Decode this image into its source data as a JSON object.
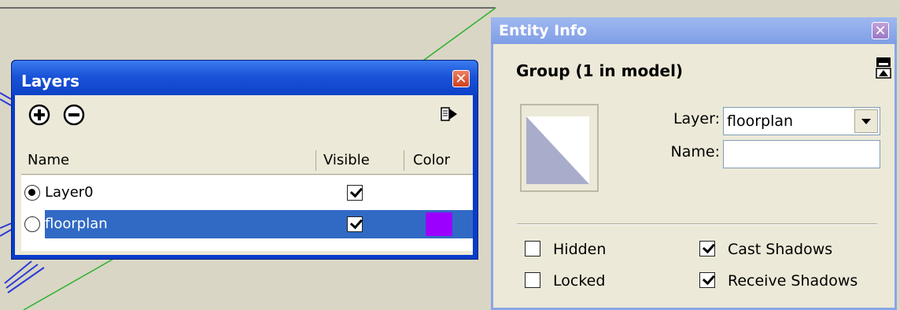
{
  "layers_panel": {
    "title": "Layers",
    "columns": [
      "Name",
      "Visible",
      "Color"
    ],
    "rows": [
      {
        "name": "Layer0",
        "active": true,
        "visible": true,
        "color": "#ffffff"
      },
      {
        "name": "floorplan",
        "active": false,
        "visible": true,
        "selected": true,
        "color": "#9b00ff"
      }
    ],
    "toolbar": {
      "add_icon": "add-layer-icon",
      "remove_icon": "remove-layer-icon",
      "details_icon": "details-arrow-icon"
    }
  },
  "entity_info": {
    "title": "Entity Info",
    "heading": "Group (1 in model)",
    "layer_label": "Layer:",
    "layer_value": "floorplan",
    "name_label": "Name:",
    "name_value": "",
    "options": {
      "hidden": {
        "label": "Hidden",
        "checked": false
      },
      "locked": {
        "label": "Locked",
        "checked": false
      },
      "cast_shadows": {
        "label": "Cast Shadows",
        "checked": true
      },
      "receive_shadows": {
        "label": "Receive Shadows",
        "checked": true
      }
    }
  },
  "colors": {
    "selection": "#316ac5",
    "floorplan_layer_color": "#9b00ff",
    "xp_title_blue": "#0a3cc8"
  }
}
